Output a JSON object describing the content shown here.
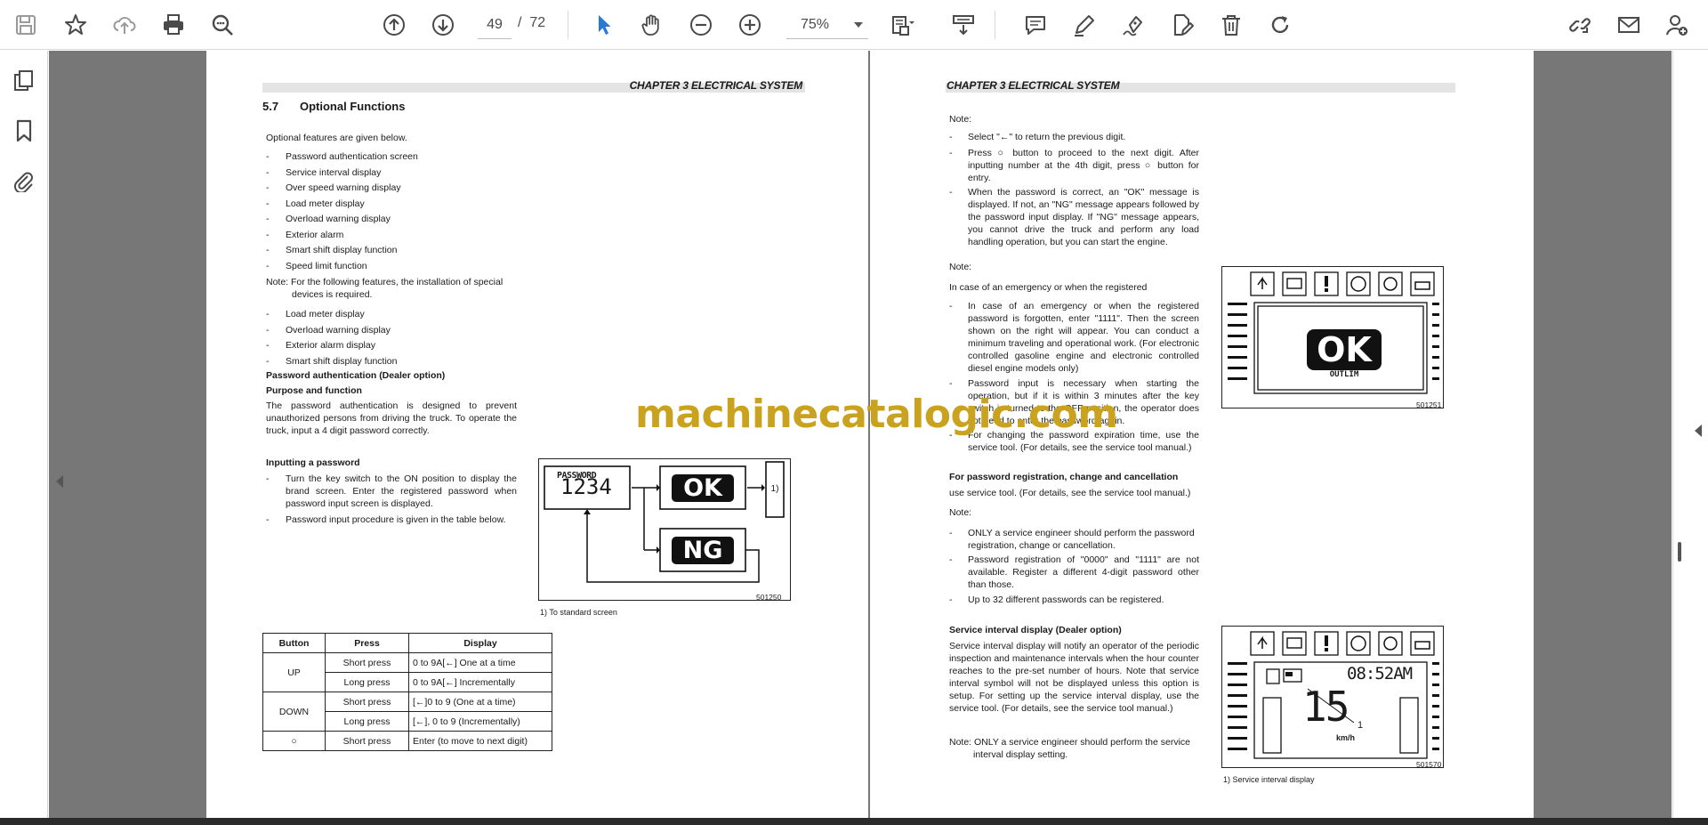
{
  "toolbar": {
    "page_current": "49",
    "page_separator": "/",
    "page_total": "72",
    "zoom": "75%",
    "icons": [
      "save-icon",
      "star-icon",
      "cloud-upload-icon",
      "print-icon",
      "zoom-icon",
      "page-up-icon",
      "page-down-icon",
      "select-cursor-icon",
      "hand-icon",
      "zoom-out-icon",
      "zoom-in-icon",
      "page-fit-icon",
      "scroll-mode-icon",
      "comment-icon",
      "pen-icon",
      "sign-icon",
      "edit-doc-icon",
      "trash-icon",
      "redo-icon",
      "share-link-icon",
      "mail-icon",
      "add-user-icon"
    ]
  },
  "sidebar": {
    "icons": [
      "pages-icon",
      "bookmark-icon",
      "attachment-icon"
    ]
  },
  "colors": {
    "accent": "#2a7ad5",
    "viewer_bg": "#777777",
    "watermark": "#c9a31f"
  },
  "watermark": "machinecatalogic.com",
  "left_page": {
    "header": "CHAPTER 3 ELECTRICAL SYSTEM",
    "section_number": "5.7",
    "section_title": "Optional Functions",
    "intro": "Optional features are given below.",
    "features": [
      "Password authentication screen",
      "Service interval display",
      "Over speed warning display",
      "Load meter display",
      "Overload warning display",
      "Exterior alarm",
      "Smart shift display function",
      "Speed limit function"
    ],
    "note_line1": "Note: For the following features, the installation of special",
    "note_line2": "devices is required.",
    "special_features": [
      "Load meter display",
      "Overload warning display",
      "Exterior alarm display",
      "Smart shift display function"
    ],
    "pw_heading": "Password authentication (Dealer option)",
    "purpose_heading": "Purpose and function",
    "purpose_text": "The password authentication is designed to prevent unauthorized persons from driving the truck. To operate the truck, input a 4 digit password correctly.",
    "input_heading": "Inputting a password",
    "input_steps": [
      "Turn the key switch to the ON position to display the brand screen. Enter the registered password when password input screen is displayed.",
      "Password input procedure is given in the table below."
    ],
    "figure": {
      "password_label": "PASSWORD",
      "password_value": "1234",
      "ok": "OK",
      "ng": "NG",
      "callout": "1)",
      "figure_number": "501250",
      "caption": "1) To standard screen"
    },
    "table": {
      "headers": [
        "Button",
        "Press",
        "Display"
      ],
      "rows": [
        {
          "button": "UP",
          "press": "Short press",
          "display": "0 to 9A[←] One at a time"
        },
        {
          "button": "",
          "press": "Long press",
          "display": "0 to 9A[←] Incrementally"
        },
        {
          "button": "DOWN",
          "press": "Short press",
          "display": "[←]0 to 9 (One at a time)"
        },
        {
          "button": "",
          "press": "Long press",
          "display": "[←], 0 to 9 (Incrementally)"
        },
        {
          "button": "○",
          "press": "Short press",
          "display": "Enter (to move to next digit)"
        }
      ]
    }
  },
  "right_page": {
    "header": "CHAPTER 3 ELECTRICAL SYSTEM",
    "note1_label": "Note:",
    "note1_items": [
      "Select \"←\" to return the previous digit.",
      "Press ○ button to proceed to the next digit. After inputting number at the 4th digit, press ○ button for entry.",
      "When the password is correct, an \"OK\" message is displayed. If not, an \"NG\" message appears followed by the password input display. If \"NG\" message appears, you cannot drive the truck and perform any load handling operation, but you can start the engine."
    ],
    "note2_label": "Note:",
    "emergency_line": "In case of an emergency or when the registered",
    "note2_items": [
      "In case of an emergency or when the registered password is forgotten, enter \"1111\". Then the screen shown on the right will appear. You can conduct a minimum traveling and operational work. (For electronic controlled gasoline engine and electronic controlled diesel engine models only)",
      "Password input is necessary when starting the operation, but if it is within 3 minutes after the key switch is turned to the OFF position, the operator does not need to enter the password again.",
      "For changing the password expiration time, use the service tool. (For details, see the service tool manual.)"
    ],
    "reg_heading": "For password registration, change and cancellation",
    "reg_text": "use service tool. (For details, see the service tool manual.)",
    "note3_label": "Note:",
    "note3_items": [
      "ONLY a service engineer should perform the password registration, change or cancellation.",
      "Password registration of \"0000\" and \"1111\" are not available. Register a different 4-digit password other than those.",
      "Up to 32 different passwords can be registered."
    ],
    "svc_heading": "Service interval display (Dealer option)",
    "svc_text": "Service interval display will notify an operator of the periodic inspection and maintenance intervals when the hour counter reaches to the pre-set number of hours. Note that service interval symbol will not be displayed unless this option is setup. For setting up the service interval display, use the service tool. (For details, see the service tool manual.)",
    "svc_note_line1": "Note: ONLY a service engineer should perform the service",
    "svc_note_line2": "interval display setting.",
    "fig1": {
      "ok": "OK",
      "sub": "OUTLIM",
      "figure_number": "501251"
    },
    "fig2": {
      "time": "08:52AM",
      "speed": "15",
      "unit": "km/h",
      "callout": "1",
      "figure_number": "501570",
      "caption": "1) Service interval display"
    }
  }
}
